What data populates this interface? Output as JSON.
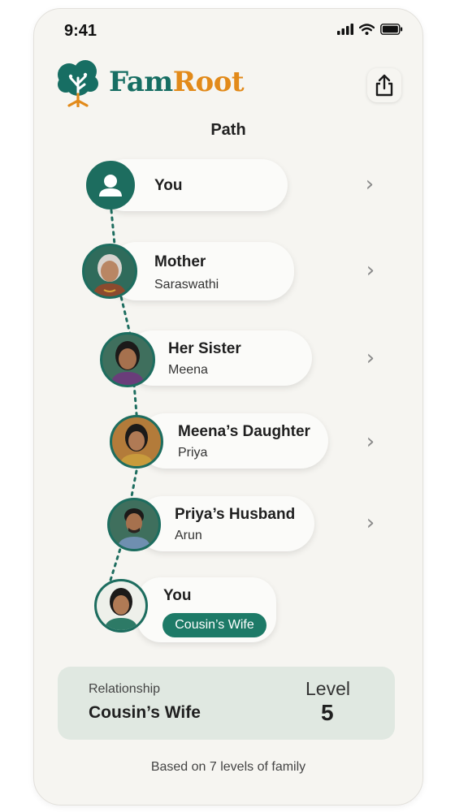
{
  "status_bar": {
    "time": "9:41",
    "signal_icon": "signal-bars-icon",
    "wifi_icon": "wifi-icon",
    "battery_icon": "battery-icon"
  },
  "header": {
    "brand_part1": "Fam",
    "brand_part2": "Root",
    "logo_icon": "tree-logo-icon",
    "share_icon": "share-icon"
  },
  "colors": {
    "brand_green": "#176e63",
    "brand_orange": "#e28a1a",
    "badge_green": "#1d7a67",
    "panel_bg": "#e0e8e1"
  },
  "path": {
    "title": "Path",
    "nodes": [
      {
        "title": "You",
        "subtitle": "",
        "avatar": "user-silhouette-icon"
      },
      {
        "title": "Mother",
        "subtitle": "Saraswathi",
        "avatar": "elderly-woman-photo"
      },
      {
        "title": "Her Sister",
        "subtitle": "Meena",
        "avatar": "woman-photo"
      },
      {
        "title": "Meena’s Daughter",
        "subtitle": "Priya",
        "avatar": "young-woman-photo"
      },
      {
        "title": "Priya’s Husband",
        "subtitle": "Arun",
        "avatar": "man-photo"
      },
      {
        "title": "You",
        "subtitle": "",
        "avatar": "young-woman-photo",
        "badge": "Cousin’s Wife"
      }
    ]
  },
  "relationship": {
    "label": "Relationship",
    "value": "Cousin’s Wife",
    "level_label": "Level",
    "level_value": "5"
  },
  "footer": {
    "text": "Based on 7 levels of family"
  }
}
